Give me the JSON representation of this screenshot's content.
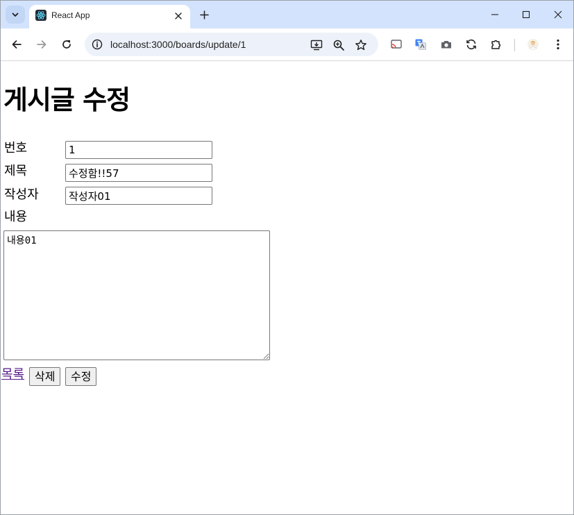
{
  "browser": {
    "tab_title": "React App",
    "url": "localhost:3000/boards/update/1"
  },
  "page": {
    "title": "게시글 수정",
    "fields": {
      "number": {
        "label": "번호",
        "value": "1"
      },
      "subject": {
        "label": "제목",
        "value": "수정함!!57"
      },
      "author": {
        "label": "작성자",
        "value": "작성자01"
      },
      "content": {
        "label": "내용",
        "value": "내용01"
      }
    },
    "actions": {
      "list_link": "목록",
      "delete_button": "삭제",
      "update_button": "수정"
    }
  },
  "icons": {
    "tab_search": "chevron-down-icon",
    "favicon": "react-icon",
    "tab_close": "close-icon",
    "new_tab": "plus-icon",
    "minimize": "minimize-icon",
    "maximize": "maximize-icon",
    "close_window": "close-icon",
    "back": "arrow-left-icon",
    "forward": "arrow-right-icon",
    "reload": "reload-icon",
    "site_info": "info-icon",
    "install": "install-icon",
    "zoom": "zoom-icon",
    "bookmark": "star-icon",
    "extensions": "puzzle-icon",
    "menu": "kebab-menu-icon"
  },
  "colors": {
    "tabstrip": "#d3e3fd",
    "omnibox": "#edf2fa",
    "link_visited": "#551a8b"
  }
}
